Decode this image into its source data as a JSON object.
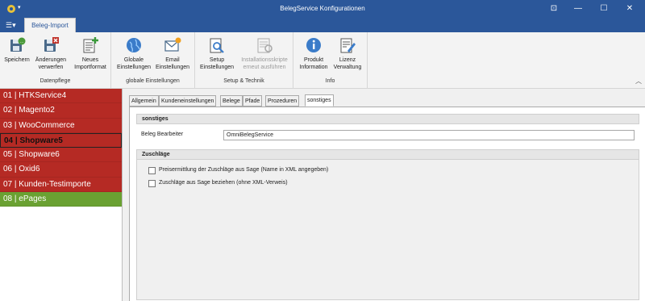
{
  "window": {
    "title": "BelegService Konfigurationen",
    "help_glyph": "⊡",
    "min_glyph": "—",
    "max_glyph": "☐",
    "close_glyph": "✕",
    "qa_arrow": "▾"
  },
  "ribbon": {
    "menu_glyph": "☰▾",
    "active_tab": "Beleg-Import",
    "collapse_glyph": "︿",
    "groups": [
      {
        "label": "Datenpflege",
        "buttons": [
          {
            "label_1": "Speichern",
            "label_2": "",
            "icon": "save-icon"
          },
          {
            "label_1": "Änderungen",
            "label_2": "verwerfen",
            "icon": "discard-icon"
          },
          {
            "label_1": "Neues",
            "label_2": "Importformat",
            "icon": "new-format-icon"
          }
        ]
      },
      {
        "label": "globale Einstellungen",
        "buttons": [
          {
            "label_1": "Globale",
            "label_2": "Einstellungen",
            "icon": "globe-icon"
          },
          {
            "label_1": "Email",
            "label_2": "Einstellungen",
            "icon": "email-icon"
          }
        ]
      },
      {
        "label": "Setup & Technik",
        "buttons": [
          {
            "label_1": "Setup",
            "label_2": "Einstellungen",
            "icon": "setup-icon"
          },
          {
            "label_1": "Installationsskripte",
            "label_2": "erneut ausführen",
            "icon": "script-icon"
          }
        ]
      },
      {
        "label": "Info",
        "buttons": [
          {
            "label_1": "Produkt",
            "label_2": "Information",
            "icon": "info-icon"
          },
          {
            "label_1": "Lizenz",
            "label_2": "Verwaltung",
            "icon": "license-icon"
          }
        ]
      }
    ]
  },
  "sidebar": {
    "items": [
      {
        "label": "01 | HTKService4"
      },
      {
        "label": "02 | Magento2"
      },
      {
        "label": "03 | WooCommerce"
      },
      {
        "label": "04 | Shopware5"
      },
      {
        "label": "05 | Shopware6"
      },
      {
        "label": "06 | Oxid6"
      },
      {
        "label": "07 | Kunden-Testimporte"
      },
      {
        "label": "08 | ePages"
      }
    ],
    "colors": {
      "red": "#b52a24",
      "green": "#6aa132"
    }
  },
  "detail": {
    "tabs": [
      "Allgemein",
      "Kundeneinstellungen",
      "Belege",
      "Pfade",
      "Prozeduren",
      "sonstiges"
    ],
    "sections": {
      "sonstiges": {
        "title": "sonstiges",
        "field_label": "Beleg Bearbeiter",
        "field_value": "OmniBelegService"
      },
      "zuschlaege": {
        "title": "Zuschläge",
        "checkbox_1": "Preisermittlung der Zuschläge aus Sage (Name in XML angegeben)",
        "checkbox_2": "Zuschläge aus Sage beziehen (ohne XML-Verweis)"
      }
    }
  },
  "colors": {
    "accent": "#2b579a"
  }
}
